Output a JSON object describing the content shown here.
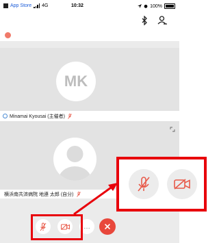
{
  "status_bar": {
    "back_app": "App Store",
    "network": "4G",
    "time": "10:32",
    "battery": "100%"
  },
  "toolbar": {
    "bluetooth_icon": "bluetooth-icon",
    "participants_icon": "user-icon"
  },
  "participants": [
    {
      "initials": "MK",
      "name": "Minamai Kyousai (主催者)",
      "mic_icon": "mic-muted-icon"
    },
    {
      "avatar_icon": "person-placeholder-icon",
      "name": "横浜南共済病院 地連 太郎 (自分)",
      "mic_icon": "mic-muted-icon"
    }
  ],
  "controls": {
    "mute_icon": "mic-muted-icon",
    "video_icon": "video-off-icon",
    "more_label": "…",
    "end_icon": "close-icon"
  },
  "colors": {
    "highlight": "#e8000b",
    "end_call": "#e8473b",
    "control_icon": "#e85a4a",
    "link": "#1a5bd8"
  }
}
